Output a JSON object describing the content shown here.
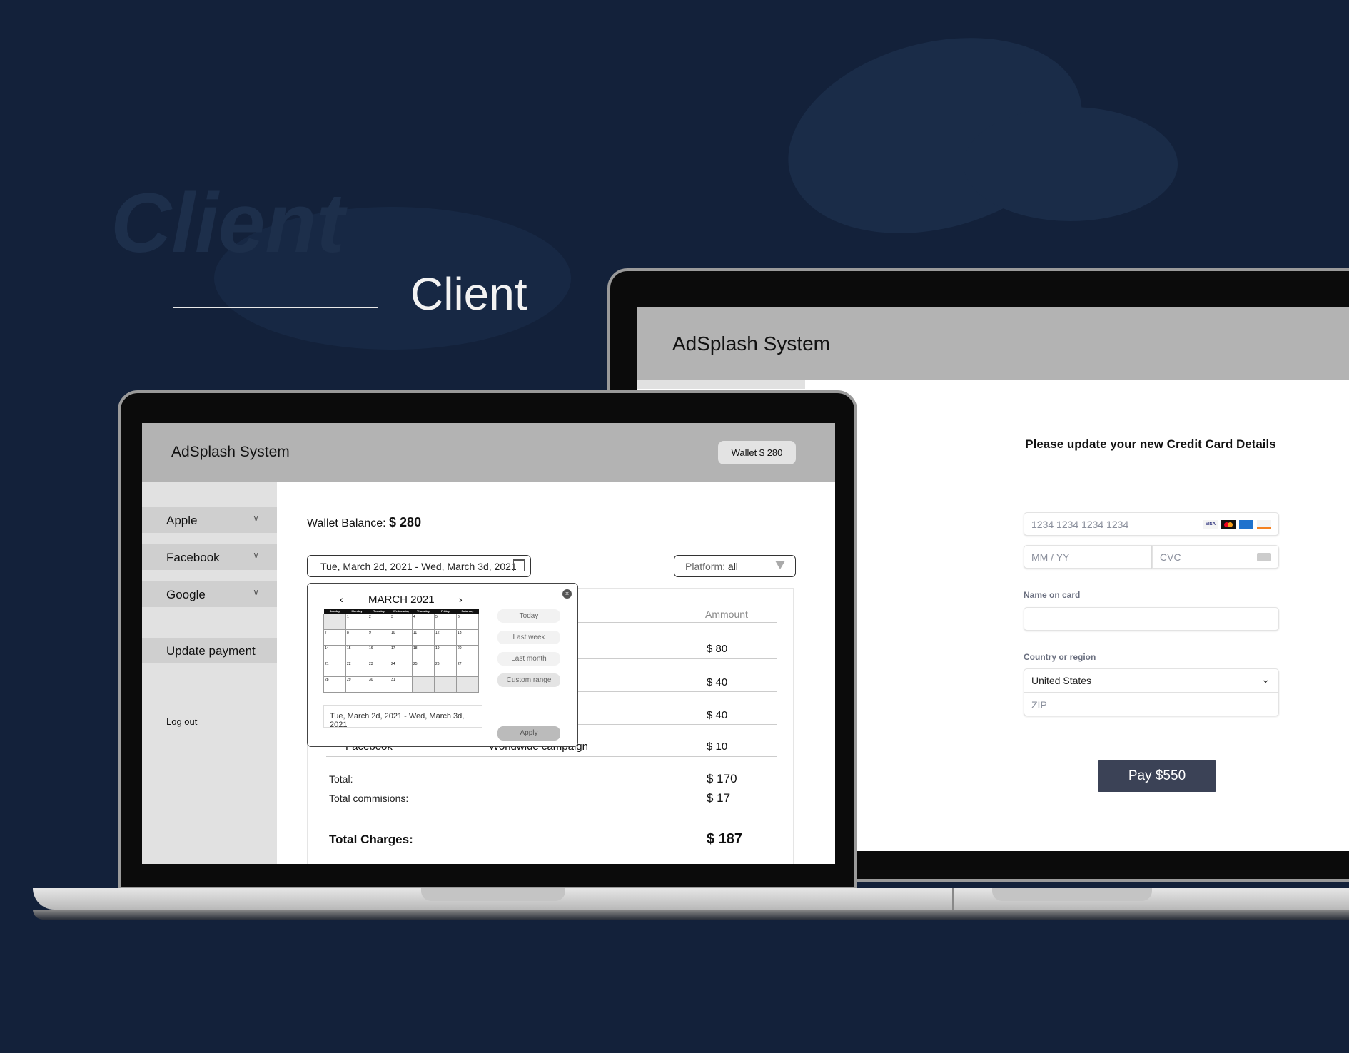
{
  "hero": {
    "watermark": "Client",
    "title": "Client"
  },
  "left_app": {
    "title": "AdSplash System",
    "wallet_badge": "Wallet $ 280",
    "sidebar": {
      "items": [
        {
          "label": "Apple"
        },
        {
          "label": "Facebook"
        },
        {
          "label": "Google"
        }
      ],
      "update_payment": "Update payment",
      "logout": "Log out"
    },
    "wallet_balance_label": "Wallet Balance:",
    "wallet_balance_value": "$ 280",
    "date_range": "Tue, March 2d, 2021 - Wed, March 3d, 2021",
    "platform_label": "Platform:",
    "platform_value": "all",
    "table": {
      "amount_header": "Ammount",
      "amounts": [
        "$ 80",
        "$ 40",
        "$ 40",
        "$ 10"
      ],
      "partial_row": {
        "platform": "Facebook",
        "campaign": "Worldwide campaign"
      },
      "total_label": "Total:",
      "total_value": "$ 170",
      "commission_label": "Total commisions:",
      "commission_value": "$ 17",
      "charges_label": "Total Charges:",
      "charges_value": "$ 187"
    },
    "datepicker": {
      "month": "MARCH  2021",
      "weekdays": [
        "Sunday",
        "Monday",
        "Tuesday",
        "Wednesday",
        "Thursday",
        "Friday",
        "Saturday"
      ],
      "selected_range": "Tue, March 2d, 2021  -  Wed, March 3d, 2021",
      "presets": [
        "Today",
        "Last week",
        "Last month",
        "Custom range"
      ],
      "apply": "Apply"
    }
  },
  "right_app": {
    "title": "AdSplash System",
    "heading": "Please update your new Credit Card Details",
    "card_number_placeholder": "1234 1234 1234 1234",
    "card_brands": [
      "VISA",
      "mastercard",
      "amex",
      "discover"
    ],
    "expiry_placeholder": "MM / YY",
    "cvc_placeholder": "CVC",
    "name_label": "Name on card",
    "country_label": "Country or region",
    "country_value": "United States",
    "zip_placeholder": "ZIP",
    "pay_button": "Pay $550",
    "pay_color": "#3b4256"
  }
}
